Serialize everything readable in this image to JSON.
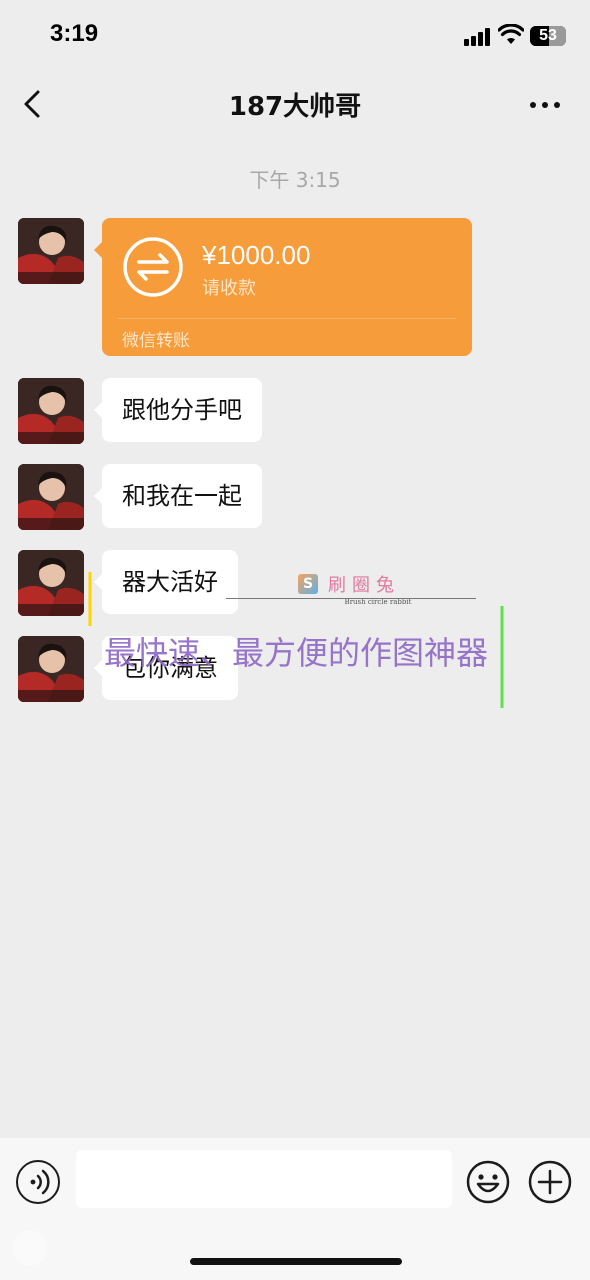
{
  "status_bar": {
    "time": "3:19",
    "battery": "53"
  },
  "nav": {
    "title": "187大帅哥",
    "back_icon": "chevron-left-icon",
    "more_icon": "more-horizontal-icon"
  },
  "chat": {
    "timestamp": "下午 3:15",
    "transfer": {
      "amount": "¥1000.00",
      "status": "请收款",
      "source": "微信转账",
      "icon": "transfer-arrows-icon",
      "color": "#f79c3a"
    },
    "messages": [
      {
        "text": "跟他分手吧"
      },
      {
        "text": "和我在一起"
      },
      {
        "text": "器大活好"
      },
      {
        "text": "包你满意"
      }
    ]
  },
  "watermark": {
    "logo_mark": "S",
    "logo_text": "刷圈兔",
    "logo_sub": "Brush circle rabbit",
    "slogan": "最快速、最方便的作图神器"
  },
  "input_bar": {
    "message_value": "",
    "voice_icon": "voice-icon",
    "emoji_icon": "emoji-icon",
    "plus_icon": "plus-icon"
  }
}
